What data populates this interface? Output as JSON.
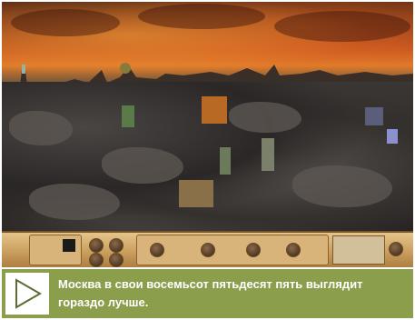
{
  "scene": {
    "description_icon": "game-city-landscape",
    "palette": {
      "sky": "#c4561f",
      "ground": "#2e2a28",
      "ui": "#d8b47a",
      "caption_bg": "#8b9e4c"
    }
  },
  "caption": {
    "text": "Москва в свои восемьсот пятьдесят пять выглядит гораздо лучше.",
    "icon": "play-triangle-icon"
  }
}
